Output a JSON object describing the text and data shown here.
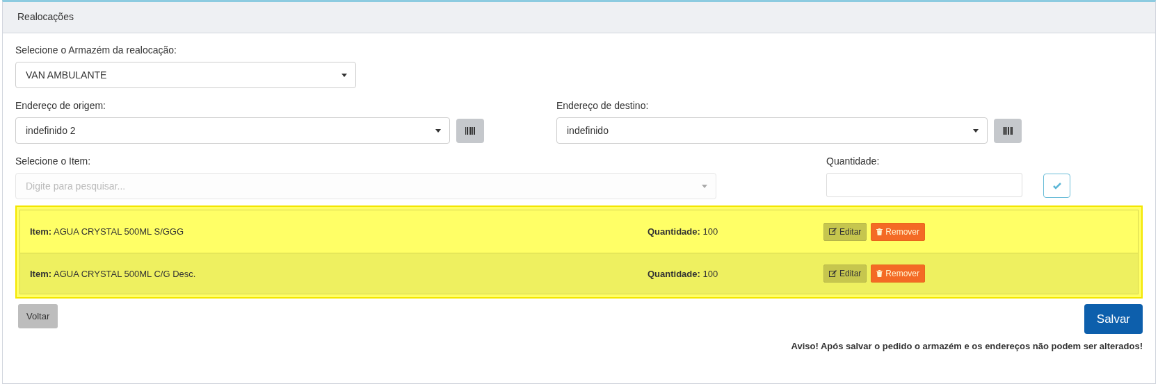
{
  "panel": {
    "title": "Realocações"
  },
  "warehouse": {
    "label": "Selecione o Armazém da realocação:",
    "value": "VAN AMBULANTE"
  },
  "origin": {
    "label": "Endereço de origem:",
    "value": "indefinido 2"
  },
  "destination": {
    "label": "Endereço de destino:",
    "value": "indefinido"
  },
  "item": {
    "label": "Selecione o Item:",
    "placeholder": "Digite para pesquisar..."
  },
  "quantity": {
    "label": "Quantidade:"
  },
  "entries": [
    {
      "item_label": "Item:",
      "item": "AGUA CRYSTAL 500ML S/GGG",
      "quantity_label": "Quantidade:",
      "quantity": "100",
      "edit": "Editar",
      "remove": "Remover"
    },
    {
      "item_label": "Item:",
      "item": "AGUA CRYSTAL 500ML C/G Desc.",
      "quantity_label": "Quantidade:",
      "quantity": "100",
      "edit": "Editar",
      "remove": "Remover"
    }
  ],
  "back_button": "Voltar",
  "save_button": "Salvar",
  "warning": "**Aviso! Após salvar o pedido o armazém e os endereços não podem ser alterados!**"
}
